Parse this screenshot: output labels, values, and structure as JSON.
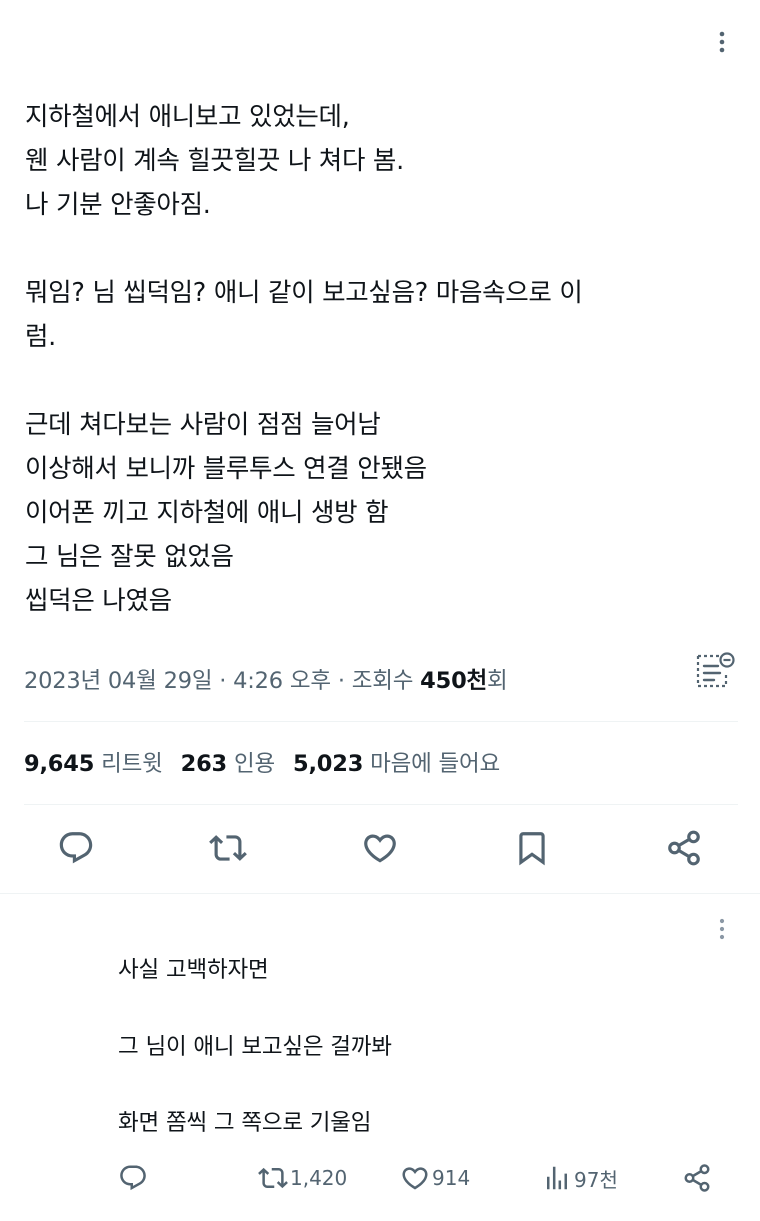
{
  "tweet": {
    "lines": [
      "지하철에서 애니보고 있었는데,",
      "웬 사람이 계속 힐끗힐끗 나 쳐다 봄.",
      "나 기분 안좋아짐.",
      "",
      "뭐임? 님 씹덕임? 애니 같이 보고싶음? 마음속으로 이",
      "럼.",
      "",
      "근데 쳐다보는 사람이 점점 늘어남",
      "이상해서 보니까 블루투스 연결 안됐음",
      "이어폰 끼고 지하철에 애니 생방 함",
      "그 님은 잘못 없었음",
      "씹덕은 나였음"
    ],
    "timestamp": "2023년 04월 29일 · 4:26 오후 · 조회수 ",
    "views_count": "450천",
    "views_suffix": "회",
    "stats": {
      "retweets_count": "9,645",
      "retweets_label": "리트윗",
      "quotes_count": "263",
      "quotes_label": "인용",
      "likes_count": "5,023",
      "likes_label": "마음에 들어요"
    },
    "icons": {
      "more": "more-vertical-icon",
      "translate": "translate-note-icon",
      "reply": "reply-icon",
      "retweet": "retweet-icon",
      "like": "heart-icon",
      "bookmark": "bookmark-icon",
      "share": "share-icon"
    }
  },
  "reply": {
    "lines": [
      "사실 고백하자면",
      "그 님이 애니 보고싶은 걸까봐",
      "화면 쫌씩 그 쪽으로 기울임"
    ],
    "actions": {
      "retweets": "1,420",
      "likes": "914",
      "views": "97천"
    }
  },
  "colors": {
    "text": "#0f1419",
    "secondary": "#536471",
    "divider": "#eff3f4"
  }
}
